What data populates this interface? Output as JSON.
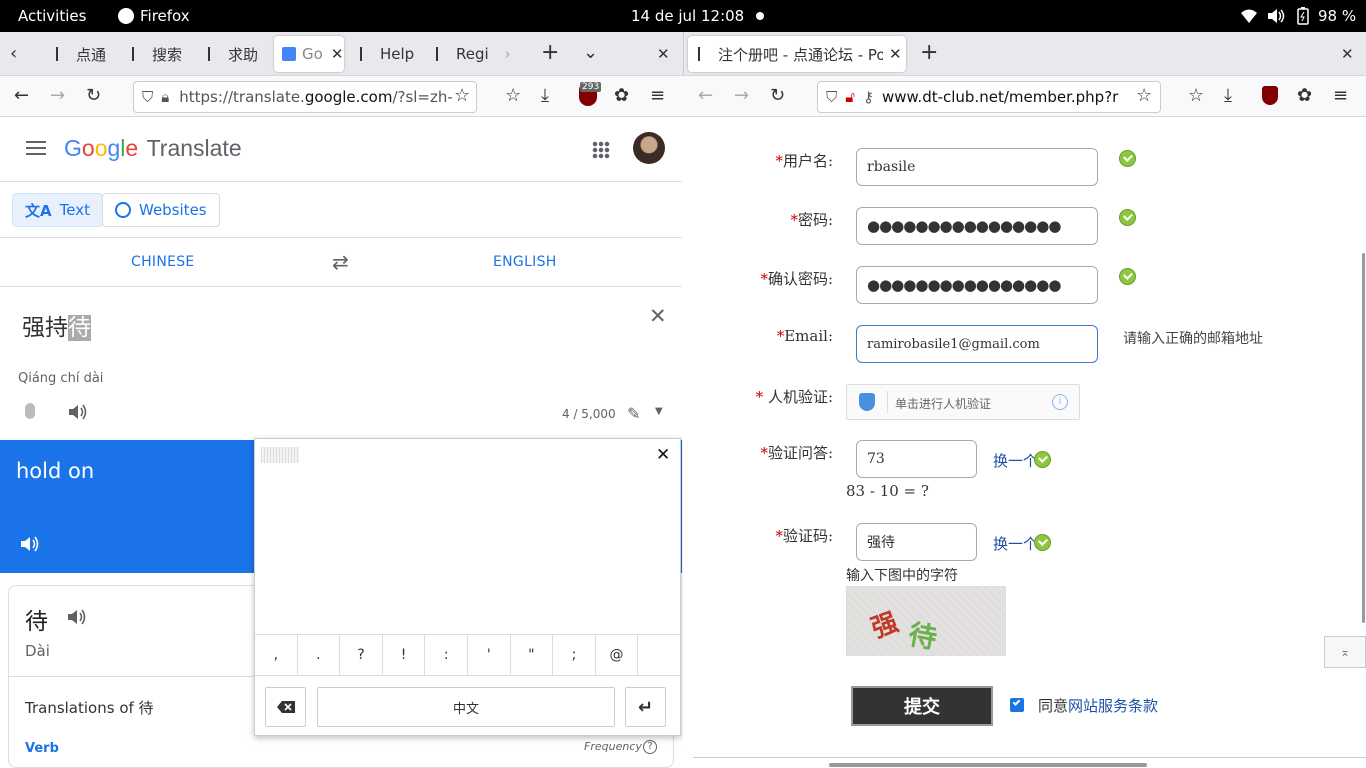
{
  "topbar": {
    "activities": "Activities",
    "app": "Firefox",
    "clock": "14 de jul  12:08",
    "battery": "98 %"
  },
  "left_window": {
    "tabs": [
      {
        "label": "点通"
      },
      {
        "label": "搜索"
      },
      {
        "label": "求助"
      },
      {
        "label": "Go"
      },
      {
        "label": "Help"
      },
      {
        "label": "Regi"
      }
    ],
    "url_prefix": "https://translate.",
    "url_domain": "google.com",
    "url_suffix": "/?sl=zh-",
    "ublock_count": "293"
  },
  "translate": {
    "logo": [
      "G",
      "o",
      "o",
      "g",
      "l",
      "e"
    ],
    "logo_colors": [
      "#4285f4",
      "#ea4335",
      "#fbbc05",
      "#4285f4",
      "#34a853",
      "#ea4335"
    ],
    "product": "Translate",
    "mode_text": "Text",
    "mode_websites": "Websites",
    "source_lang": "CHINESE",
    "target_lang": "ENGLISH",
    "source_text": "强持",
    "source_text_selected": "待",
    "pinyin": "Qiáng chí dài",
    "char_count": "4 / 5,000",
    "translation": "hold on",
    "dict_char": "待",
    "dict_pinyin": "Dài",
    "translations_of": "Translations of 待",
    "pos": "Verb",
    "frequency": "Frequency"
  },
  "keyboard": {
    "keys": [
      ",",
      ".",
      "?",
      "!",
      ":",
      "'",
      "\"",
      ";",
      "@",
      ""
    ],
    "lang_key": "中文"
  },
  "right_window": {
    "tab_title": "注个册吧 - 点通论坛 - Pow",
    "url": "www.dt-club.net/member.php?r"
  },
  "form": {
    "username_label": "用户名:",
    "username_value": "rbasile",
    "password_label": "密码:",
    "password_value": "●●●●●●●●●●●●●●●●",
    "confirm_label": "确认密码:",
    "confirm_value": "●●●●●●●●●●●●●●●●",
    "email_label": "Email:",
    "email_value": "ramirobasile1@gmail.com",
    "email_hint": "请输入正确的邮箱地址",
    "captcha_human_label": " 人机验证:",
    "captcha_human_text": "单击进行人机验证",
    "question_label": "验证问答:",
    "question_value": "73",
    "question_refresh": "换一个",
    "question_text": "83 - 10 = ?",
    "code_label": "验证码:",
    "code_value": "强待",
    "code_refresh": "换一个",
    "code_hint": "输入下图中的字符",
    "captcha_img_text": [
      "强",
      "待"
    ],
    "submit": "提交",
    "agree_prefix": "同意",
    "agree_link": "网站服务条款"
  }
}
